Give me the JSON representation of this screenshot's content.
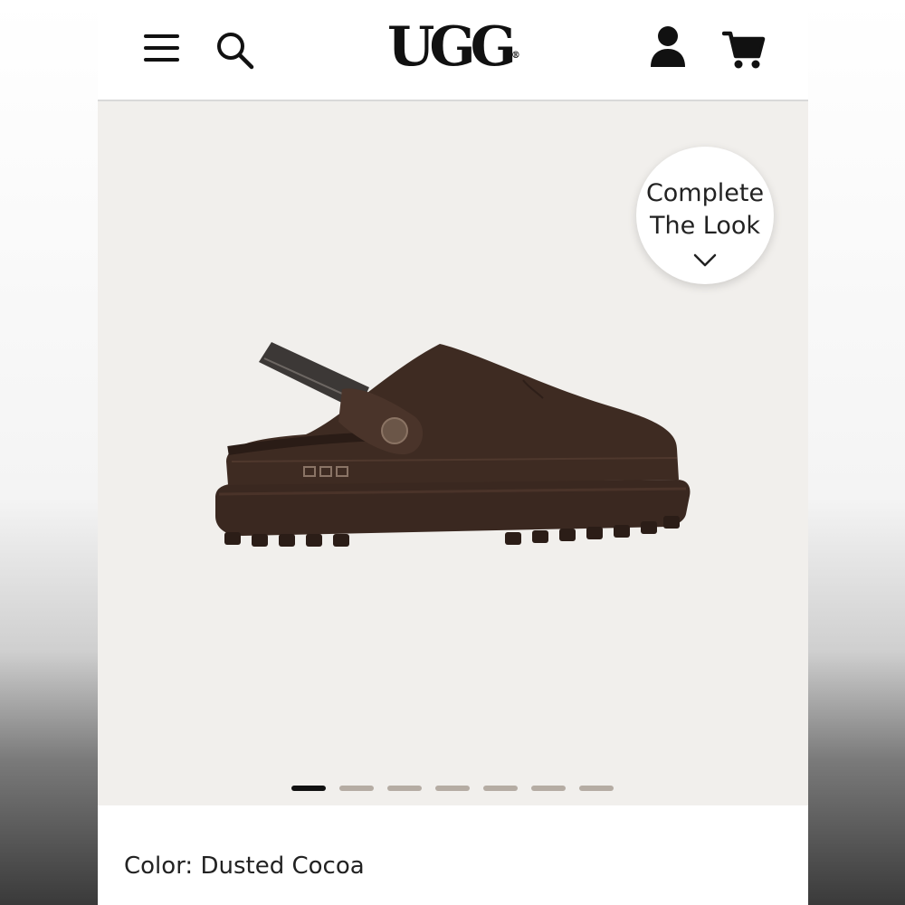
{
  "header": {
    "brand": "UGG",
    "brand_mark": "®",
    "icons": [
      "menu-icon",
      "search-icon",
      "account-icon",
      "cart-icon"
    ]
  },
  "hero": {
    "complete_the_look_line1": "Complete",
    "complete_the_look_line2": "The Look",
    "carousel": {
      "total": 7,
      "active_index": 0
    },
    "colors": {
      "background": "#f1efec",
      "shoe": "#3e2b22",
      "sole": "#3a2820"
    }
  },
  "product": {
    "color_label": "Color:",
    "color_value": "Dusted Cocoa"
  }
}
